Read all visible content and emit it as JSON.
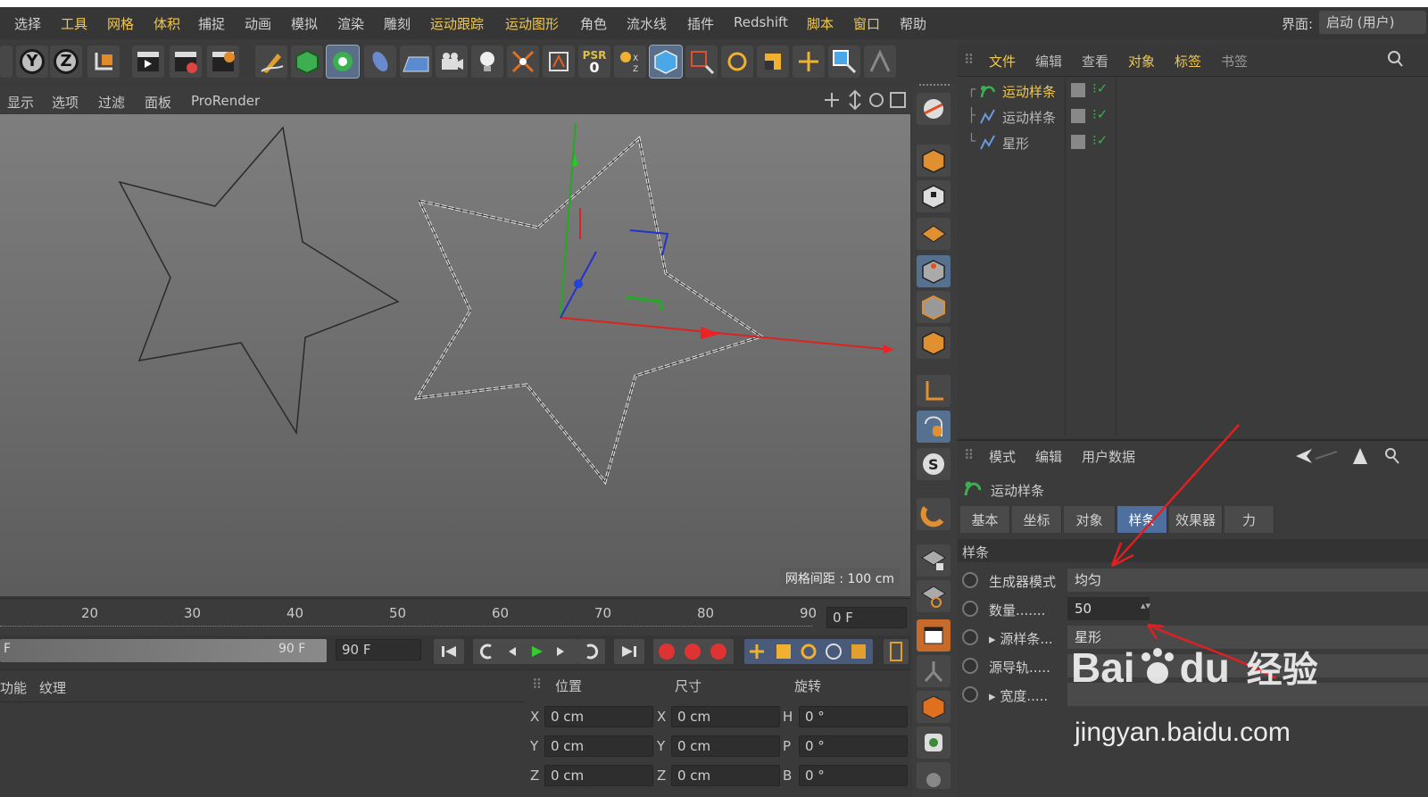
{
  "menubar": {
    "items": [
      "选择",
      "工具",
      "网格",
      "体积",
      "捕捉",
      "动画",
      "模拟",
      "渲染",
      "雕刻",
      "运动跟踪",
      "运动图形",
      "角色",
      "流水线",
      "插件",
      "Redshift",
      "脚本",
      "窗口",
      "帮助"
    ],
    "layout_label": "界面:",
    "layout_value": "启动 (用户)"
  },
  "toolbar": {
    "axis_y": "Y",
    "axis_z": "Z",
    "psr_label": "PSR",
    "psr_value": "0"
  },
  "viewport": {
    "menu": [
      "显示",
      "选项",
      "过滤",
      "面板",
      "ProRender"
    ],
    "grid_spacing": "网格间距 : 100 cm"
  },
  "timeline": {
    "ticks": [
      "20",
      "30",
      "40",
      "50",
      "60",
      "70",
      "80",
      "90"
    ],
    "current_frame": "0 F",
    "start_label": "F",
    "end_slider": "90 F",
    "end_field": "90 F"
  },
  "left_bottom": {
    "tabs": [
      "功能",
      "纹理"
    ]
  },
  "coords": {
    "headers": [
      "位置",
      "尺寸",
      "旋转"
    ],
    "rows": [
      {
        "a": "X",
        "av": "0 cm",
        "b": "X",
        "bv": "0 cm",
        "c": "H",
        "cv": "0 °"
      },
      {
        "a": "Y",
        "av": "0 cm",
        "b": "Y",
        "bv": "0 cm",
        "c": "P",
        "cv": "0 °"
      },
      {
        "a": "Z",
        "av": "0 cm",
        "b": "Z",
        "bv": "0 cm",
        "c": "B",
        "cv": "0 °"
      }
    ]
  },
  "object_manager": {
    "menu": [
      "文件",
      "编辑",
      "查看",
      "对象",
      "标签",
      "书签"
    ],
    "objects": [
      {
        "name": "运动样条",
        "selected": true
      },
      {
        "name": "运动样条",
        "selected": false
      },
      {
        "name": "星形",
        "selected": false
      }
    ]
  },
  "attributes": {
    "menu": [
      "模式",
      "编辑",
      "用户数据"
    ],
    "object_name": "运动样条",
    "tabs": [
      "基本",
      "坐标",
      "对象",
      "样条",
      "效果器",
      "力"
    ],
    "active_tab": "样条",
    "section": "样条",
    "props": [
      {
        "label": "生成器模式",
        "value": "均匀"
      },
      {
        "label": "数量.......",
        "value": "50"
      },
      {
        "label": "源样条...",
        "value": "星形"
      },
      {
        "label": "源导轨.....",
        "value": ""
      },
      {
        "label": "宽度.....",
        "value": ""
      }
    ]
  },
  "watermark": {
    "brand": "Bai",
    "brand2": "du",
    "brand_cn": "经验",
    "url": "jingyan.baidu.com"
  },
  "colors": {
    "accent": "#f0c850",
    "active_tab": "#4f6f9e",
    "annotation_red": "#e02020"
  }
}
